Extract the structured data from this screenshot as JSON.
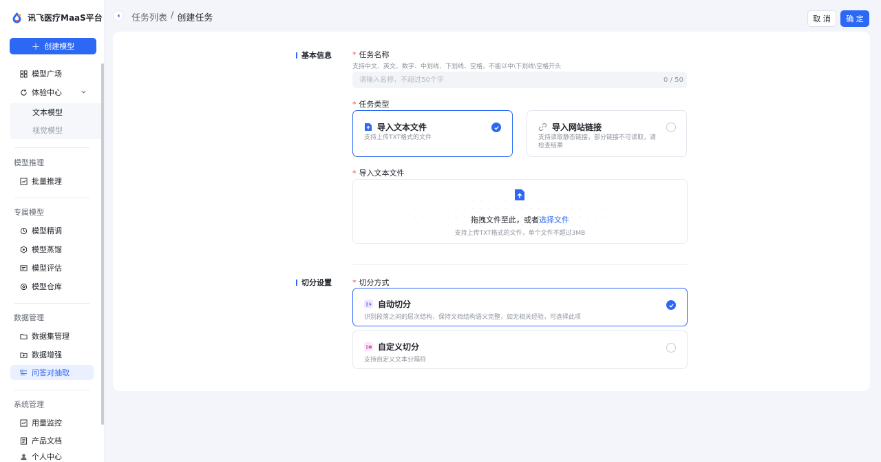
{
  "brand": {
    "name": "讯飞医疗MaaS平台"
  },
  "sidebar": {
    "create_label": "创建模型",
    "items": {
      "model_square": "模型广场",
      "experience": "体验中心",
      "text_model": "文本模型",
      "vision_model": "视觉模型",
      "batch_infer": "批量推理",
      "finetune": "模型精调",
      "distill": "模型蒸馏",
      "evaluate": "模型评估",
      "warehouse": "模型仓库",
      "dataset": "数据集管理",
      "augment": "数据增强",
      "qa_extract": "问答对抽取",
      "usage": "用量监控",
      "docs": "产品文档",
      "profile": "个人中心"
    },
    "groups": {
      "inference": "模型推理",
      "exclusive": "专属模型",
      "data": "数据管理",
      "system": "系统管理"
    }
  },
  "header": {
    "breadcrumb_parent": "任务列表",
    "separator": "/",
    "breadcrumb_current": "创建任务",
    "cancel_label": "取 消",
    "ok_label": "确 定"
  },
  "form": {
    "basic_section": "基本信息",
    "name_label": "任务名称",
    "name_hint": "支持中文、英文、数字、中划线、下划线、空格，不能以中\\下划线\\空格开头",
    "name_placeholder": "请输入名称，不超过50个字",
    "name_counter": "0 / 50",
    "type_label": "任务类型",
    "type_options": [
      {
        "title": "导入文本文件",
        "desc": "支持上传TXT格式的文件",
        "selected": true
      },
      {
        "title": "导入网站链接",
        "desc": "支持读取静态链接，部分链接不可读取，请检查结果",
        "selected": false
      }
    ],
    "upload_label": "导入文本文件",
    "upload_text": "拖拽文件至此，或者",
    "upload_link": "选择文件",
    "upload_hint": "支持上传TXT格式的文件，单个文件不超过3MB",
    "split_section": "切分设置",
    "split_label": "切分方式",
    "split_options": [
      {
        "title": "自动切分",
        "desc": "识别段落之间的层次结构，保持文档结构语义完整，如无相关经验，可选择此项",
        "selected": true
      },
      {
        "title": "自定义切分",
        "desc": "支持自定义文本分隔符",
        "selected": false
      }
    ]
  },
  "colors": {
    "accent": "#2c68f4",
    "required": "#f54a45"
  }
}
